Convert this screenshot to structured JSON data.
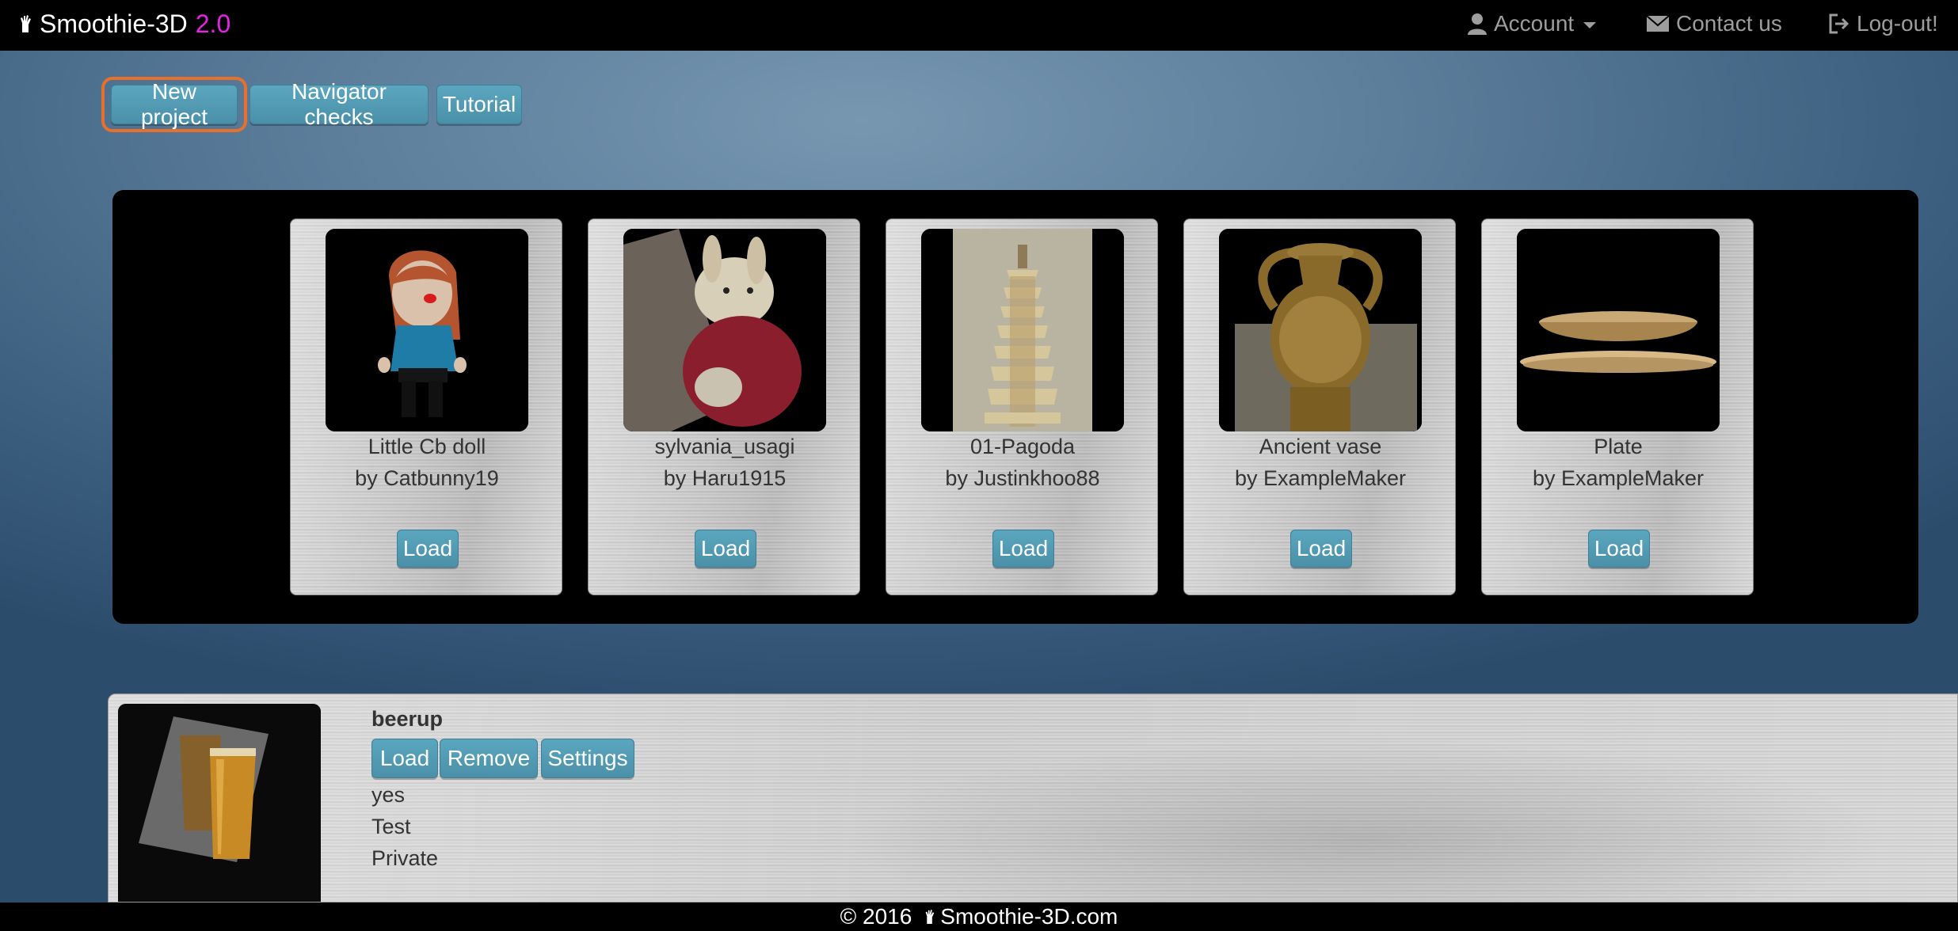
{
  "navbar": {
    "brand": "Smoothie-3D",
    "version": "2.0",
    "account_label": "Account",
    "contact_label": "Contact us",
    "logout_label": "Log-out!"
  },
  "toolbar": {
    "new_project": "New project",
    "navigator_checks": "Navigator checks",
    "tutorial": "Tutorial"
  },
  "gallery": {
    "items": [
      {
        "title": "Little Cb doll",
        "author": "by Catbunny19",
        "load": "Load"
      },
      {
        "title": "sylvania_usagi",
        "author": "by Haru1915",
        "load": "Load"
      },
      {
        "title": "01-Pagoda",
        "author": "by Justinkhoo88",
        "load": "Load"
      },
      {
        "title": "Ancient vase",
        "author": "by ExampleMaker",
        "load": "Load"
      },
      {
        "title": "Plate",
        "author": "by ExampleMaker",
        "load": "Load"
      }
    ]
  },
  "project": {
    "name": "beerup",
    "load": "Load",
    "remove": "Remove",
    "settings": "Settings",
    "line1": "yes",
    "line2": "Test",
    "line3": "Private"
  },
  "footer": {
    "copyright": "© 2016",
    "site": "Smoothie-3D.com"
  },
  "colors": {
    "button": "#4a90a8",
    "brand_version": "#e523e5",
    "focus_ring": "#e7702c",
    "navbar": "#000000"
  },
  "icons": [
    "hand-logo-icon",
    "user-icon",
    "envelope-icon",
    "logout-icon"
  ]
}
